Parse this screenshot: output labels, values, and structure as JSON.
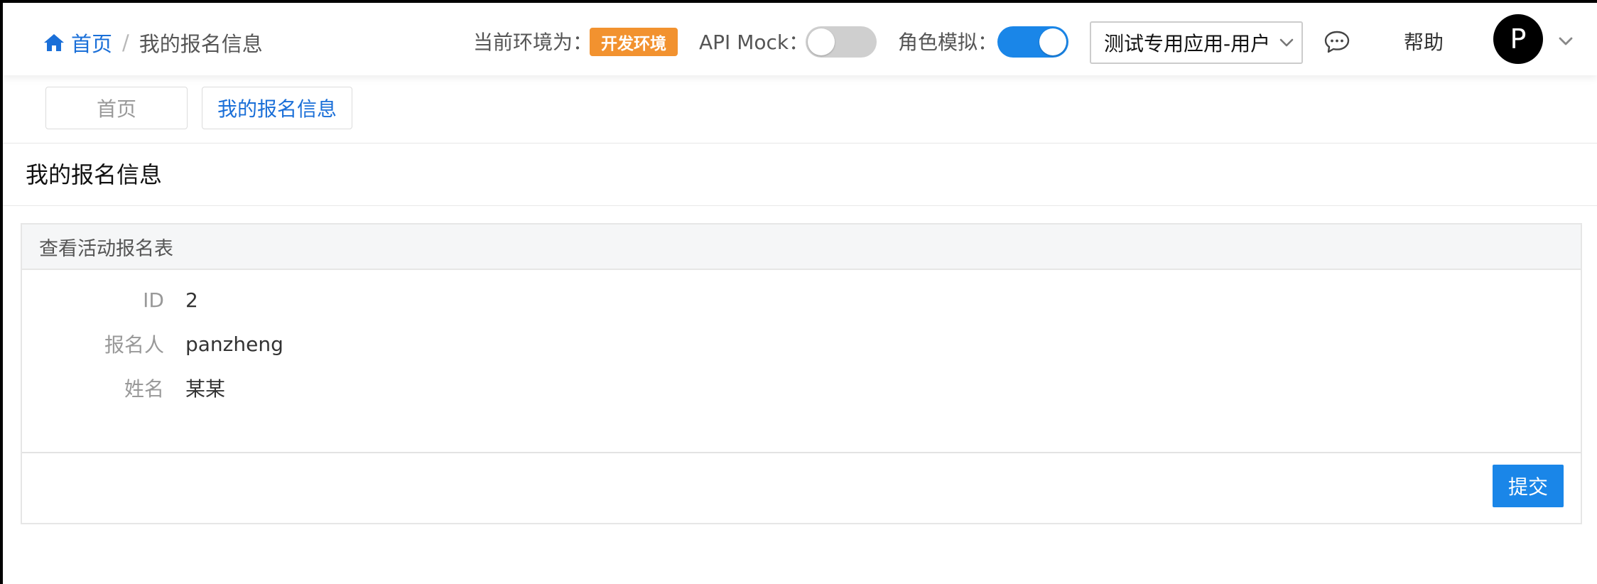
{
  "header": {
    "breadcrumb": {
      "home_label": "首页",
      "separator": "/",
      "current_label": "我的报名信息"
    },
    "env_label": "当前环境为：",
    "env_badge": "开发环境",
    "api_mock_label": "API Mock：",
    "api_mock_enabled": false,
    "role_label": "角色模拟：",
    "role_enabled": true,
    "app_select_value": "测试专用应用-用户",
    "message_icon": "chat-bubble-icon",
    "help_label": "帮助",
    "avatar_letter": "P"
  },
  "tabs": [
    {
      "label": "首页",
      "active": false
    },
    {
      "label": "我的报名信息",
      "active": true
    }
  ],
  "page_title": "我的报名信息",
  "panel": {
    "heading": "查看活动报名表",
    "fields": [
      {
        "label": "ID",
        "value": "2"
      },
      {
        "label": "报名人",
        "value": "panzheng"
      },
      {
        "label": "姓名",
        "value": "某某"
      }
    ],
    "submit_label": "提交"
  },
  "colors": {
    "accent": "#1a86e8",
    "link": "#1a6fd8",
    "env_badge": "#f2922f",
    "switch_off": "#cfcfcf"
  }
}
